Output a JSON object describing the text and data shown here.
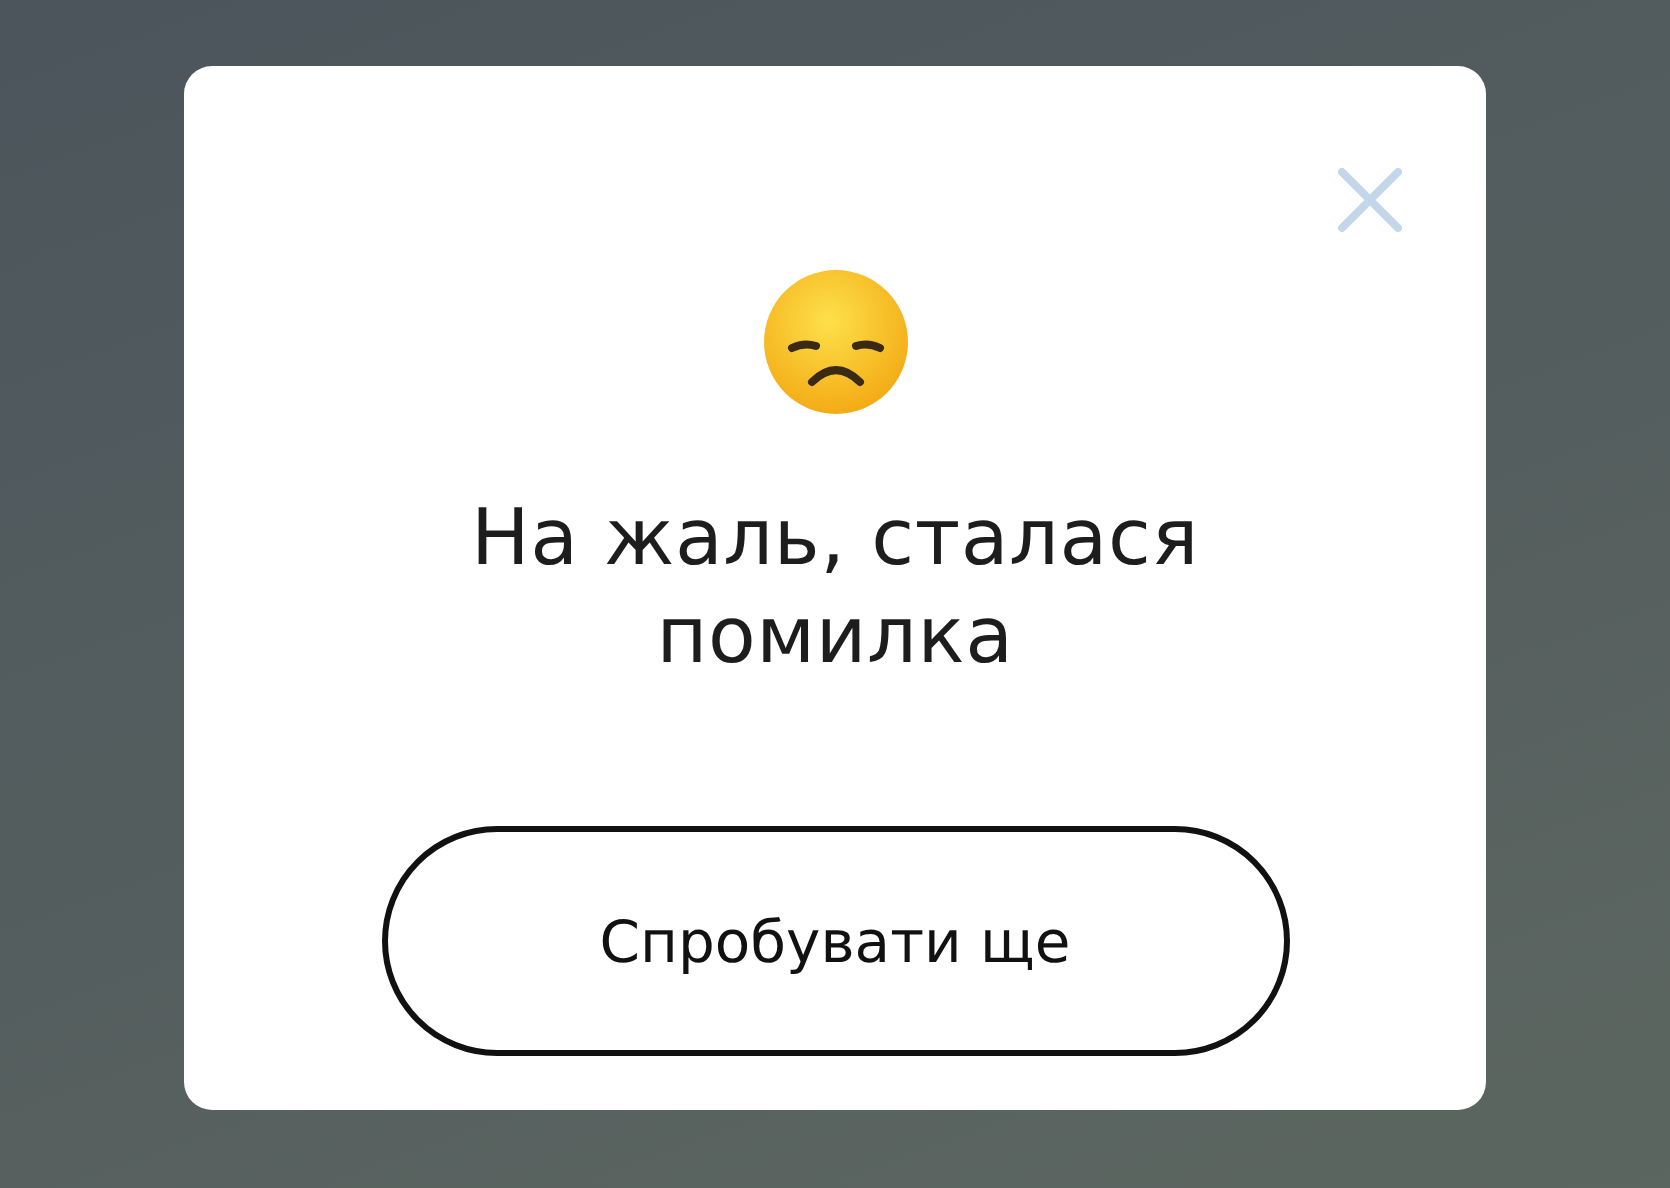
{
  "dialog": {
    "title": "На жаль, сталася помилка",
    "button": "Спробувати ще"
  }
}
